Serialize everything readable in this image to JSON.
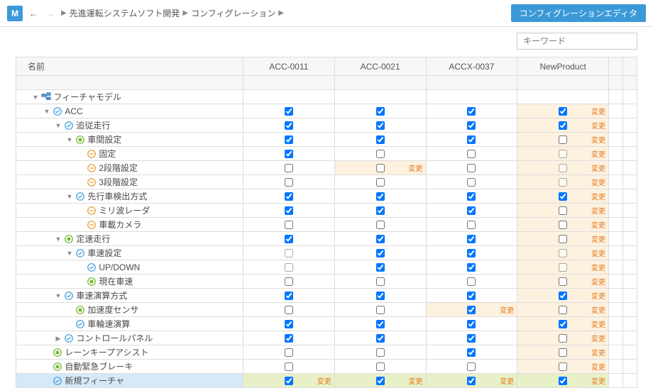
{
  "app_icon_label": "M",
  "breadcrumb": [
    "先進運転システムソフト開発",
    "コンフィグレーション"
  ],
  "editor_button": "コンフィグレーションエディタ",
  "search_placeholder": "キーワード",
  "columns": {
    "name": "名前",
    "config": [
      "ACC-0011",
      "ACC-0021",
      "ACCX-0037",
      "NewProduct"
    ]
  },
  "change_label": "変更",
  "rows": [
    {
      "depth": 0,
      "tog": "▼",
      "icon": "model",
      "label": "フィーチャモデル",
      "cells": [
        null,
        null,
        null,
        null
      ]
    },
    {
      "depth": 1,
      "tog": "▼",
      "icon": "chk",
      "label": "ACC",
      "cells": [
        {
          "c": true
        },
        {
          "c": true
        },
        {
          "c": true
        },
        {
          "c": true,
          "h": true,
          "chg": true
        }
      ]
    },
    {
      "depth": 2,
      "tog": "▼",
      "icon": "chk",
      "label": "追従走行",
      "cells": [
        {
          "c": true
        },
        {
          "c": true
        },
        {
          "c": true
        },
        {
          "c": true,
          "h": true,
          "chg": true
        }
      ]
    },
    {
      "depth": 3,
      "tog": "▼",
      "icon": "dot",
      "label": "車間設定",
      "cells": [
        {
          "c": true
        },
        {
          "c": true
        },
        {
          "c": true
        },
        {
          "c": false,
          "h": true,
          "chg": true
        }
      ]
    },
    {
      "depth": 4,
      "tog": "",
      "icon": "opt",
      "label": "固定",
      "cells": [
        {
          "c": true
        },
        {
          "c": false
        },
        {
          "c": false
        },
        {
          "c": false,
          "g": true,
          "h": true,
          "chg": true
        }
      ]
    },
    {
      "depth": 4,
      "tog": "",
      "icon": "opt",
      "label": "2段階設定",
      "cells": [
        {
          "c": false
        },
        {
          "c": false,
          "h": true,
          "chg": true
        },
        {
          "c": false
        },
        {
          "c": false,
          "g": true,
          "h": true,
          "chg": true
        }
      ]
    },
    {
      "depth": 4,
      "tog": "",
      "icon": "opt",
      "label": "3段階設定",
      "cells": [
        {
          "c": false
        },
        {
          "c": false
        },
        {
          "c": false
        },
        {
          "c": false,
          "g": true,
          "h": true,
          "chg": true
        }
      ]
    },
    {
      "depth": 3,
      "tog": "▼",
      "icon": "chk",
      "label": "先行車検出方式",
      "cells": [
        {
          "c": true
        },
        {
          "c": true
        },
        {
          "c": true
        },
        {
          "c": true,
          "h": true,
          "chg": true
        }
      ]
    },
    {
      "depth": 4,
      "tog": "",
      "icon": "opt",
      "label": "ミリ波レーダ",
      "cells": [
        {
          "c": true
        },
        {
          "c": true
        },
        {
          "c": true
        },
        {
          "c": false,
          "h": true,
          "chg": true
        }
      ]
    },
    {
      "depth": 4,
      "tog": "",
      "icon": "opt",
      "label": "車載カメラ",
      "cells": [
        {
          "c": false
        },
        {
          "c": false
        },
        {
          "c": false
        },
        {
          "c": false,
          "h": true,
          "chg": true
        }
      ]
    },
    {
      "depth": 2,
      "tog": "▼",
      "icon": "dot",
      "label": "定速走行",
      "cells": [
        {
          "c": true
        },
        {
          "c": true
        },
        {
          "c": true
        },
        {
          "c": false,
          "h": true,
          "chg": true
        }
      ]
    },
    {
      "depth": 3,
      "tog": "▼",
      "icon": "chk",
      "label": "車速設定",
      "cells": [
        {
          "c": false,
          "g": true
        },
        {
          "c": true
        },
        {
          "c": true
        },
        {
          "c": false,
          "g": true,
          "h": true,
          "chg": true
        }
      ]
    },
    {
      "depth": 4,
      "tog": "",
      "icon": "chk",
      "label": "UP/DOWN",
      "cells": [
        {
          "c": false,
          "g": true
        },
        {
          "c": true
        },
        {
          "c": true
        },
        {
          "c": false,
          "g": true,
          "h": true,
          "chg": true
        }
      ]
    },
    {
      "depth": 4,
      "tog": "",
      "icon": "dot",
      "label": "現在車速",
      "cells": [
        {
          "c": false
        },
        {
          "c": false
        },
        {
          "c": false
        },
        {
          "c": false,
          "h": true,
          "chg": true
        }
      ]
    },
    {
      "depth": 2,
      "tog": "▼",
      "icon": "chk",
      "label": "車速演算方式",
      "cells": [
        {
          "c": true
        },
        {
          "c": true
        },
        {
          "c": true
        },
        {
          "c": true,
          "h": true,
          "chg": true
        }
      ]
    },
    {
      "depth": 3,
      "tog": "",
      "icon": "dot",
      "label": "加速度センサ",
      "cells": [
        {
          "c": false
        },
        {
          "c": false
        },
        {
          "c": true,
          "h": true,
          "chg": true
        },
        {
          "c": false,
          "h": true,
          "chg": true
        }
      ]
    },
    {
      "depth": 3,
      "tog": "",
      "icon": "chk",
      "label": "車輪速演算",
      "cells": [
        {
          "c": true
        },
        {
          "c": true
        },
        {
          "c": true
        },
        {
          "c": true,
          "h": true,
          "chg": true
        }
      ]
    },
    {
      "depth": 2,
      "tog": "▶",
      "icon": "chk",
      "label": "コントロールパネル",
      "cells": [
        {
          "c": true
        },
        {
          "c": true
        },
        {
          "c": true
        },
        {
          "c": false,
          "h": true,
          "chg": true
        }
      ]
    },
    {
      "depth": 1,
      "tog": "",
      "icon": "dot",
      "label": "レーンキープアシスト",
      "cells": [
        {
          "c": false
        },
        {
          "c": false
        },
        {
          "c": true
        },
        {
          "c": false,
          "h": true,
          "chg": true
        }
      ]
    },
    {
      "depth": 1,
      "tog": "",
      "icon": "dot",
      "label": "自動緊急ブレーキ",
      "cells": [
        {
          "c": false
        },
        {
          "c": false
        },
        {
          "c": false
        },
        {
          "c": false,
          "h": true,
          "chg": true
        }
      ]
    },
    {
      "depth": 1,
      "tog": "",
      "icon": "chk",
      "label": "新規フィーチャ",
      "sel": true,
      "cells": [
        {
          "c": true,
          "sel": true,
          "chg": true
        },
        {
          "c": true,
          "sel": true,
          "chg": true
        },
        {
          "c": true,
          "sel": true,
          "chg": true
        },
        {
          "c": true,
          "sel": true,
          "chg": true
        }
      ]
    }
  ]
}
